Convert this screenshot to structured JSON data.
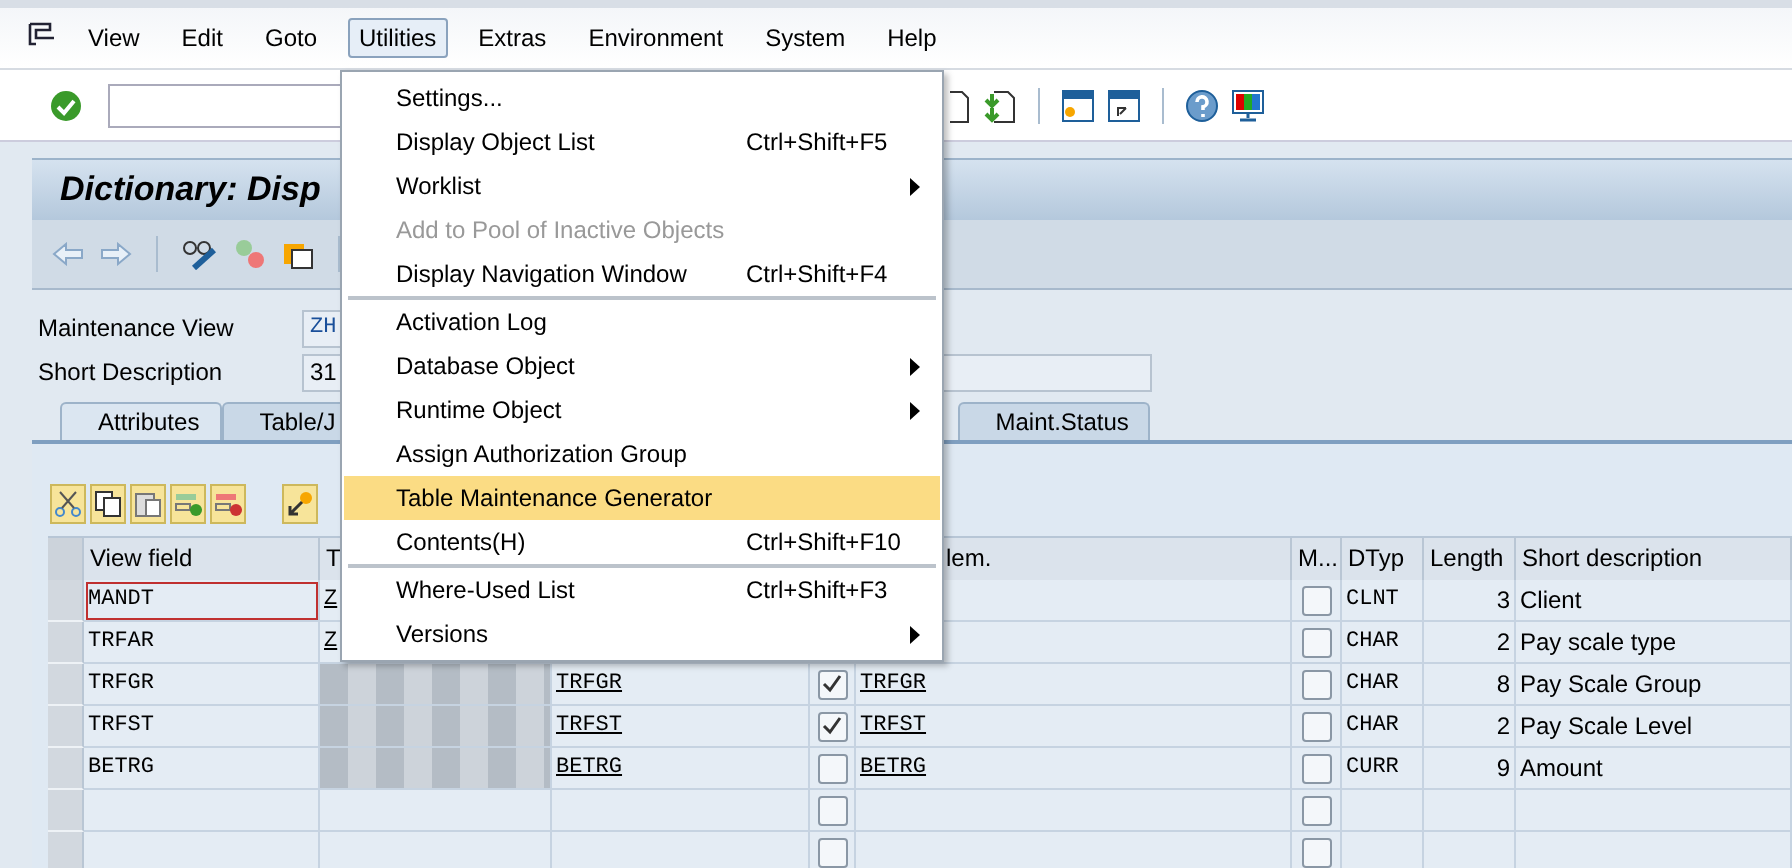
{
  "menu_bar": [
    {
      "label": "View",
      "selected": false
    },
    {
      "label": "Edit",
      "selected": false
    },
    {
      "label": "Goto",
      "selected": false
    },
    {
      "label": "Utilities",
      "selected": true
    },
    {
      "label": "Extras",
      "selected": false
    },
    {
      "label": "Environment",
      "selected": false
    },
    {
      "label": "System",
      "selected": false
    },
    {
      "label": "Help",
      "selected": false
    }
  ],
  "title": "Dictionary: Disp",
  "fields": [
    {
      "label": "Maintenance View",
      "value": "ZH"
    },
    {
      "label": "Short Description",
      "value": "31"
    }
  ],
  "tabs": [
    {
      "label": "Attributes",
      "selected": true
    },
    {
      "label": "Table/J",
      "selected": false
    },
    {
      "label": "Maint.Status",
      "selected": false
    }
  ],
  "table": {
    "columns": [
      {
        "label": "View field"
      },
      {
        "label": "T"
      },
      {},
      {},
      {
        "label": "lem."
      },
      {
        "label": "M..."
      },
      {
        "label": "DTyp"
      },
      {
        "label": "Length"
      },
      {
        "label": "Short description"
      }
    ],
    "rows": [
      {
        "view_field": "MANDT",
        "focused": true,
        "redacted": false,
        "column_2": "Z",
        "m_checked": false,
        "dtyp": "CLNT",
        "length": "3",
        "description": "Client"
      },
      {
        "view_field": "TRFAR",
        "focused": false,
        "redacted": false,
        "column_2": "Z",
        "m_checked": false,
        "dtyp": "CHAR",
        "length": "2",
        "description": "Pay scale type"
      },
      {
        "view_field": "TRFGR",
        "focused": false,
        "redacted": true,
        "column_3": "TRFGR",
        "checked": true,
        "data_element": "TRFGR",
        "m_checked": false,
        "dtyp": "CHAR",
        "length": "8",
        "description": "Pay Scale Group"
      },
      {
        "view_field": "TRFST",
        "focused": false,
        "redacted": true,
        "column_3": "TRFST",
        "checked": true,
        "data_element": "TRFST",
        "m_checked": false,
        "dtyp": "CHAR",
        "length": "2",
        "description": "Pay Scale Level"
      },
      {
        "view_field": "BETRG",
        "focused": false,
        "redacted": true,
        "column_3": "BETRG",
        "checked": false,
        "data_element": "BETRG",
        "m_checked": false,
        "dtyp": "CURR",
        "length": "9",
        "description": "Amount"
      },
      {
        "focused": false,
        "redacted": false,
        "checked": false,
        "m_checked": false
      },
      {
        "focused": false,
        "redacted": false,
        "checked": false,
        "m_checked": false
      }
    ]
  },
  "menu": {
    "items": [
      {
        "label": "Settings...",
        "selected": false,
        "disabled": false
      },
      {
        "label": "Display Object List",
        "shortcut": "Ctrl+Shift+F5",
        "selected": false,
        "disabled": false
      },
      {
        "label": "Worklist",
        "submenu": true,
        "selected": false,
        "disabled": false
      },
      {
        "label": "Add to Pool of Inactive Objects",
        "selected": false,
        "disabled": true
      },
      {
        "label": "Display Navigation Window",
        "shortcut": "Ctrl+Shift+F4",
        "selected": false,
        "disabled": false,
        "separator_after": true
      },
      {
        "label": "Activation Log",
        "selected": false,
        "disabled": false
      },
      {
        "label": "Database Object",
        "submenu": true,
        "selected": false,
        "disabled": false
      },
      {
        "label": "Runtime Object",
        "submenu": true,
        "selected": false,
        "disabled": false
      },
      {
        "label": "Assign Authorization Group",
        "selected": false,
        "disabled": false
      },
      {
        "label": "Table Maintenance Generator",
        "selected": true,
        "disabled": false
      },
      {
        "label": "Contents(H)",
        "shortcut": "Ctrl+Shift+F10",
        "selected": false,
        "disabled": false,
        "separator_after": true
      },
      {
        "label": "Where-Used List",
        "shortcut": "Ctrl+Shift+F3",
        "selected": false,
        "disabled": false
      },
      {
        "label": "Versions",
        "submenu": true,
        "selected": false,
        "disabled": false
      }
    ]
  }
}
